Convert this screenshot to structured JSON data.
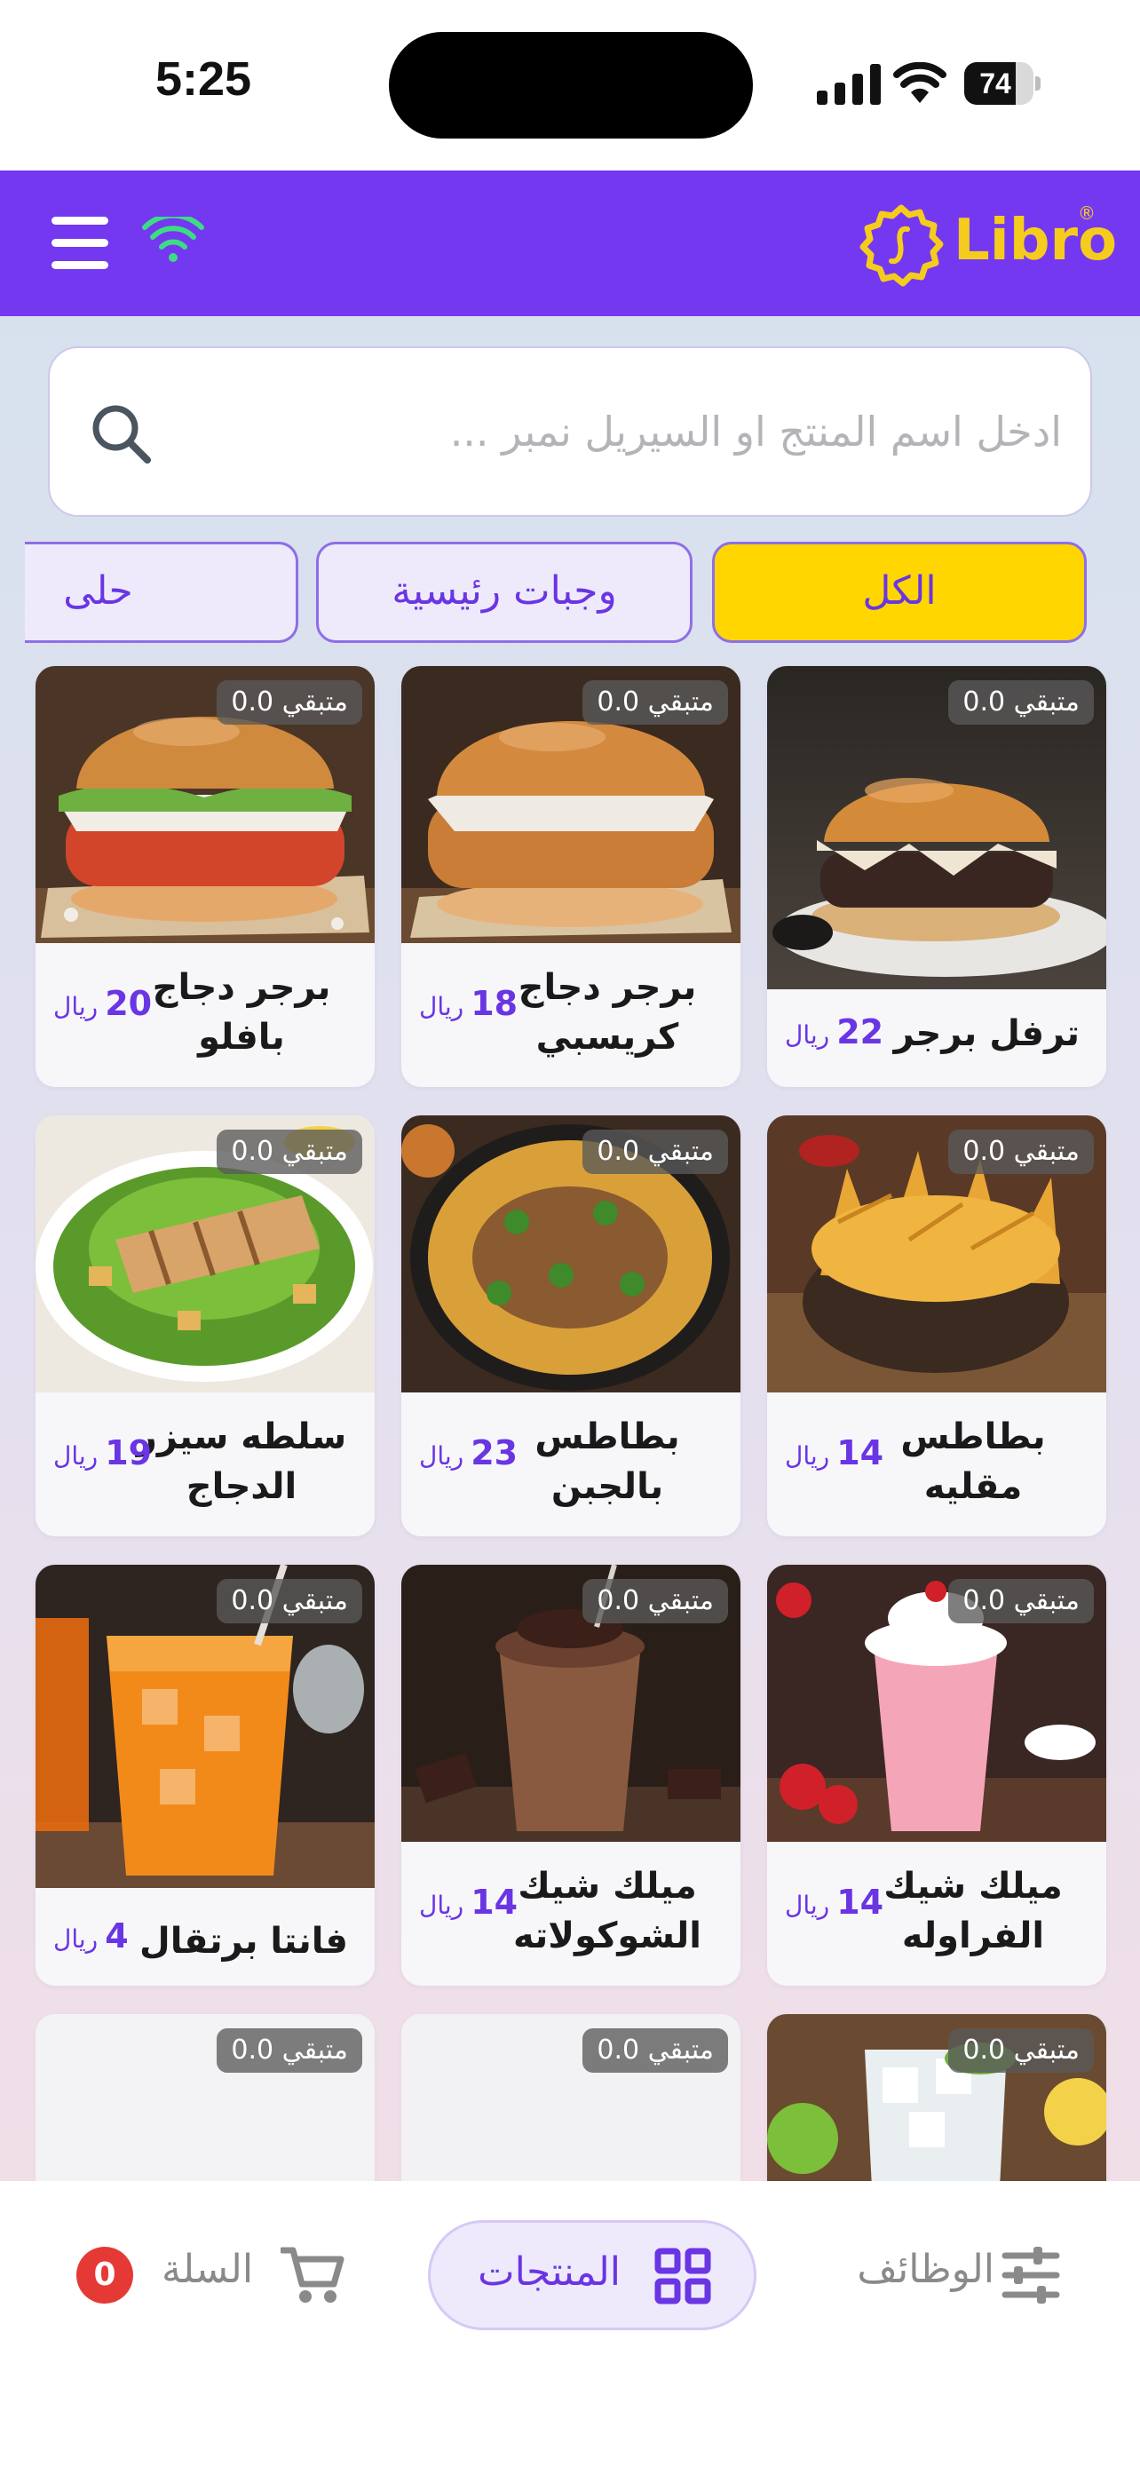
{
  "status_bar": {
    "time": "5:25",
    "battery": "74",
    "battery_level": 0.74
  },
  "header": {
    "logo_text": "Libro",
    "logo_mark": "®"
  },
  "search": {
    "placeholder": "ادخل اسم المنتج او السيريل نمبر ...",
    "value": ""
  },
  "categories": [
    {
      "label": "الكل",
      "active": true
    },
    {
      "label": "وجبات رئيسية",
      "active": false
    },
    {
      "label": "حلى",
      "active": false
    }
  ],
  "products": [
    {
      "name": "ترفل برجر",
      "price": "22",
      "currency": "ريال",
      "stock": "متبقي 0.0"
    },
    {
      "name": "برجر دجاج كريسبي",
      "price": "18",
      "currency": "ريال",
      "stock": "متبقي 0.0"
    },
    {
      "name": "برجر دجاج بافلو",
      "price": "20",
      "currency": "ريال",
      "stock": "متبقي 0.0"
    },
    {
      "name": "بطاطس مقليه",
      "price": "14",
      "currency": "ريال",
      "stock": "متبقي 0.0"
    },
    {
      "name": "بطاطس بالجبن",
      "price": "23",
      "currency": "ريال",
      "stock": "متبقي 0.0"
    },
    {
      "name": "سلطه سيزر الدجاج",
      "price": "19",
      "currency": "ريال",
      "stock": "متبقي 0.0"
    },
    {
      "name": "ميلك شيك الفراوله",
      "price": "14",
      "currency": "ريال",
      "stock": "متبقي 0.0"
    },
    {
      "name": "ميلك شيك الشوكولاته",
      "price": "14",
      "currency": "ريال",
      "stock": "متبقي 0.0"
    },
    {
      "name": "فانتا برتقال",
      "price": "4",
      "currency": "ريال",
      "stock": "متبقي 0.0"
    },
    {
      "stock": "متبقي 0.0"
    },
    {
      "stock": "متبقي 0.0"
    },
    {
      "stock": "متبقي 0.0"
    }
  ],
  "bottom_nav": {
    "tools_label": "الوظائف",
    "products_label": "المنتجات",
    "cart_label": "السلة",
    "cart_count": "0"
  },
  "colors": {
    "brand": "#7338f0",
    "accent": "#ffd600",
    "logo": "#f5cc1e",
    "badge_red": "#e53935"
  }
}
